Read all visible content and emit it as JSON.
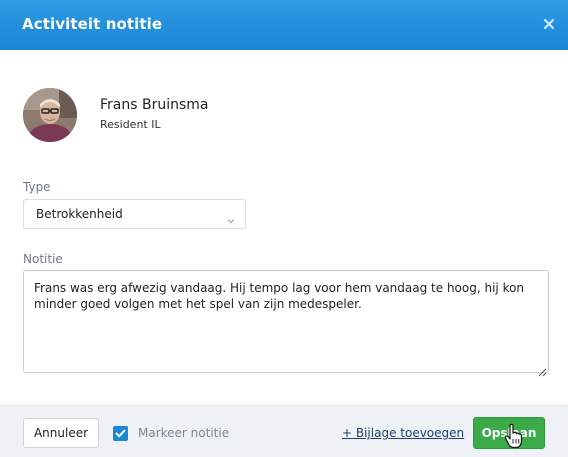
{
  "modal": {
    "title": "Activiteit notitie",
    "close_icon": "close-icon",
    "accent_color": "#1a86d6"
  },
  "resident": {
    "name": "Frans Bruinsma",
    "role": "Resident IL",
    "avatar_icon": "avatar-photo"
  },
  "form": {
    "type_label": "Type",
    "type_value": "Betrokkenheid",
    "type_chevron_icon": "chevron-down-icon",
    "note_label": "Notitie",
    "note_value": "Frans was erg afwezig vandaag. Hij tempo lag voor hem vandaag te hoog, hij kon minder goed volgen met het spel van zijn medespeler."
  },
  "footer": {
    "cancel_label": "Annuleer",
    "mark_label": "Markeer notitie",
    "mark_checked": true,
    "attach_label": "+ Bijlage toevoegen",
    "save_label": "Opslaan",
    "save_color": "#3bab4a"
  }
}
